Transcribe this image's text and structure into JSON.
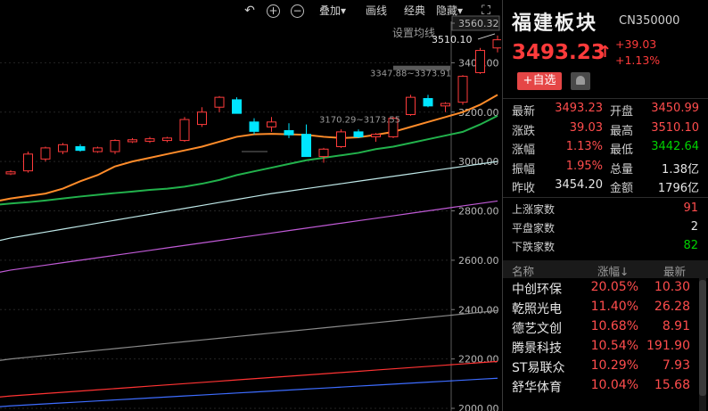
{
  "toolbar": {
    "overlay": "叠加▾",
    "draw": "画线",
    "classic": "经典",
    "hide": "隐藏▾"
  },
  "chart": {
    "ma_setting": "设置均线",
    "price_labels": [
      "3560.32",
      "3400.00",
      "3200.00",
      "3000.00",
      "2800.00",
      "2600.00",
      "2400.00",
      "2200.00",
      "2000.00"
    ],
    "high_annotation": "3510.10",
    "range_annotation_1": "3347.88~3373.91",
    "range_annotation_2": "3170.29~3173.55",
    "colors": {
      "up": "#ff3b3b",
      "down": "#00e5ff",
      "ma5": "#ff8c2a",
      "ma10": "#22b24c",
      "ma_a": "#bfe8e8",
      "ma_b": "#c05ad6",
      "ma_c": "#8a8a8a",
      "ma_d": "#ff3333",
      "ma_e": "#3d6cff"
    }
  },
  "chart_data": {
    "type": "candlestick",
    "ylim": [
      2000,
      3600
    ],
    "candles": [
      {
        "o": 2950,
        "h": 2965,
        "l": 2945,
        "c": 2958
      },
      {
        "o": 2962,
        "h": 3040,
        "l": 2955,
        "c": 3030
      },
      {
        "o": 3010,
        "h": 3060,
        "l": 3000,
        "c": 3055
      },
      {
        "o": 3040,
        "h": 3075,
        "l": 3030,
        "c": 3068
      },
      {
        "o": 3060,
        "h": 3070,
        "l": 3040,
        "c": 3045
      },
      {
        "o": 3040,
        "h": 3060,
        "l": 3035,
        "c": 3055
      },
      {
        "o": 3040,
        "h": 3090,
        "l": 3030,
        "c": 3085
      },
      {
        "o": 3080,
        "h": 3095,
        "l": 3075,
        "c": 3088
      },
      {
        "o": 3082,
        "h": 3100,
        "l": 3075,
        "c": 3092
      },
      {
        "o": 3085,
        "h": 3100,
        "l": 3078,
        "c": 3095
      },
      {
        "o": 3085,
        "h": 3180,
        "l": 3080,
        "c": 3170
      },
      {
        "o": 3150,
        "h": 3220,
        "l": 3140,
        "c": 3200
      },
      {
        "o": 3220,
        "h": 3265,
        "l": 3200,
        "c": 3260
      },
      {
        "o": 3250,
        "h": 3260,
        "l": 3200,
        "c": 3195
      },
      {
        "o": 3160,
        "h": 3175,
        "l": 3110,
        "c": 3122
      },
      {
        "o": 3140,
        "h": 3180,
        "l": 3120,
        "c": 3160
      },
      {
        "o": 3125,
        "h": 3155,
        "l": 3095,
        "c": 3108
      },
      {
        "o": 3110,
        "h": 3150,
        "l": 3025,
        "c": 3020
      },
      {
        "o": 3020,
        "h": 3055,
        "l": 2995,
        "c": 3050
      },
      {
        "o": 3060,
        "h": 3130,
        "l": 3055,
        "c": 3120
      },
      {
        "o": 3120,
        "h": 3130,
        "l": 3095,
        "c": 3100
      },
      {
        "o": 3100,
        "h": 3115,
        "l": 3080,
        "c": 3110
      },
      {
        "o": 3100,
        "h": 3180,
        "l": 3095,
        "c": 3175
      },
      {
        "o": 3190,
        "h": 3270,
        "l": 3185,
        "c": 3260
      },
      {
        "o": 3255,
        "h": 3270,
        "l": 3220,
        "c": 3225
      },
      {
        "o": 3225,
        "h": 3240,
        "l": 3200,
        "c": 3235
      },
      {
        "o": 3240,
        "h": 3350,
        "l": 3230,
        "c": 3345
      },
      {
        "o": 3360,
        "h": 3460,
        "l": 3355,
        "c": 3450
      },
      {
        "o": 3460,
        "h": 3510,
        "l": 3442,
        "c": 3493
      }
    ],
    "lines": [
      {
        "key": "ma5",
        "values": [
          2850,
          2860,
          2870,
          2890,
          2920,
          2945,
          2980,
          3000,
          3015,
          3030,
          3045,
          3060,
          3080,
          3100,
          3110,
          3112,
          3110,
          3108,
          3100,
          3095,
          3098,
          3108,
          3120,
          3140,
          3160,
          3180,
          3200,
          3230,
          3270
        ]
      },
      {
        "key": "ma10",
        "values": [
          2830,
          2835,
          2842,
          2850,
          2858,
          2865,
          2872,
          2878,
          2885,
          2890,
          2898,
          2910,
          2925,
          2945,
          2960,
          2975,
          2990,
          3005,
          3015,
          3025,
          3035,
          3050,
          3060,
          3075,
          3090,
          3105,
          3120,
          3150,
          3185
        ]
      },
      {
        "key": "ma_a",
        "values": [
          2690,
          2702,
          2714,
          2726,
          2738,
          2750,
          2762,
          2774,
          2786,
          2798,
          2810,
          2822,
          2834,
          2846,
          2858,
          2870,
          2880,
          2890,
          2900,
          2910,
          2920,
          2930,
          2940,
          2950,
          2960,
          2970,
          2980,
          2990,
          3000
        ]
      },
      {
        "key": "ma_b",
        "values": [
          2560,
          2570,
          2580,
          2590,
          2600,
          2610,
          2620,
          2630,
          2640,
          2650,
          2660,
          2670,
          2680,
          2690,
          2700,
          2710,
          2720,
          2730,
          2740,
          2750,
          2760,
          2770,
          2780,
          2790,
          2800,
          2810,
          2820,
          2830,
          2840
        ]
      },
      {
        "key": "ma_c",
        "values": [
          2200,
          2207,
          2214,
          2221,
          2228,
          2235,
          2242,
          2249,
          2256,
          2263,
          2270,
          2277,
          2284,
          2291,
          2298,
          2305,
          2312,
          2319,
          2326,
          2333,
          2340,
          2347,
          2354,
          2361,
          2368,
          2375,
          2382,
          2389,
          2396
        ]
      },
      {
        "key": "ma_d",
        "values": [
          2050,
          2055,
          2060,
          2065,
          2070,
          2075,
          2080,
          2085,
          2090,
          2095,
          2100,
          2105,
          2110,
          2115,
          2120,
          2125,
          2130,
          2135,
          2140,
          2145,
          2150,
          2155,
          2160,
          2165,
          2170,
          2175,
          2180,
          2185,
          2190
        ]
      },
      {
        "key": "ma_e",
        "values": [
          2010,
          2014,
          2018,
          2022,
          2026,
          2030,
          2034,
          2038,
          2042,
          2046,
          2050,
          2054,
          2058,
          2062,
          2066,
          2070,
          2074,
          2078,
          2082,
          2086,
          2090,
          2094,
          2098,
          2102,
          2106,
          2110,
          2114,
          2118,
          2122
        ]
      }
    ]
  },
  "panel": {
    "title": "福建板块",
    "code": "CN350000",
    "price": "3493.23",
    "change": "+39.03",
    "change_pct": "+1.13%",
    "add_btn": "+自选",
    "quote": [
      {
        "l1": "最新",
        "v1": "3493.23",
        "c1": "#ff4d4d",
        "l2": "开盘",
        "v2": "3450.99",
        "c2": "#ff4d4d"
      },
      {
        "l1": "涨跌",
        "v1": "39.03",
        "c1": "#ff4d4d",
        "l2": "最高",
        "v2": "3510.10",
        "c2": "#ff4d4d"
      },
      {
        "l1": "涨幅",
        "v1": "1.13%",
        "c1": "#ff4d4d",
        "l2": "最低",
        "v2": "3442.64",
        "c2": "#00d200"
      },
      {
        "l1": "振幅",
        "v1": "1.95%",
        "c1": "#ff4d4d",
        "l2": "总量",
        "v2": "1.38亿",
        "c2": "#e6e6e6"
      },
      {
        "l1": "昨收",
        "v1": "3454.20",
        "c1": "#e6e6e6",
        "l2": "金额",
        "v2": "1796亿",
        "c2": "#e6e6e6"
      }
    ],
    "breadth": [
      {
        "label": "上涨家数",
        "value": "91",
        "color": "#ff4d4d"
      },
      {
        "label": "平盘家数",
        "value": "2",
        "color": "#e6e6e6"
      },
      {
        "label": "下跌家数",
        "value": "82",
        "color": "#00d200"
      }
    ],
    "list_header": {
      "name": "名称",
      "pct": "涨幅↓",
      "price": "最新"
    },
    "list": [
      {
        "name": "中创环保",
        "pct": "20.05%",
        "price": "10.30"
      },
      {
        "name": "乾照光电",
        "pct": "11.40%",
        "price": "26.28"
      },
      {
        "name": "德艺文创",
        "pct": "10.68%",
        "price": "8.91"
      },
      {
        "name": "腾景科技",
        "pct": "10.54%",
        "price": "191.90"
      },
      {
        "name": "ST易联众",
        "pct": "10.29%",
        "price": "7.93"
      },
      {
        "name": "舒华体育",
        "pct": "10.04%",
        "price": "15.68"
      }
    ]
  }
}
